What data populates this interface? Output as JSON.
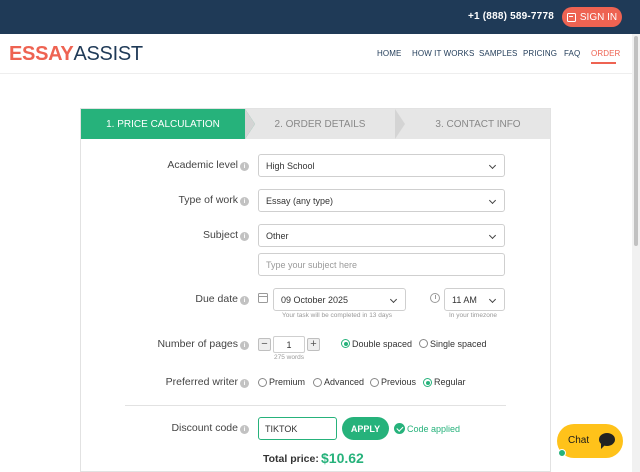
{
  "topbar": {
    "phone": "+1 (888) 589-7778",
    "signin_label": "SIGN IN"
  },
  "logo": {
    "part1": "ESSAY",
    "part2": "ASSIST"
  },
  "nav": [
    "HOME",
    "HOW IT WORKS",
    "SAMPLES",
    "PRICING",
    "FAQ",
    "ORDER"
  ],
  "nav_active": "ORDER",
  "steps": [
    "1. PRICE CALCULATION",
    "2. ORDER DETAILS",
    "3. CONTACT INFO"
  ],
  "form": {
    "academic_level": {
      "label": "Academic level",
      "value": "High School"
    },
    "type_of_work": {
      "label": "Type of work",
      "value": "Essay (any type)"
    },
    "subject": {
      "label": "Subject",
      "value": "Other",
      "placeholder": "Type your subject here"
    },
    "due_date": {
      "label": "Due date",
      "date": "09 October 2025",
      "date_hint": "Your task will be completed in 13 days",
      "time": "11 AM",
      "time_hint": "In your timezone"
    },
    "pages": {
      "label": "Number of pages",
      "value": "1",
      "words": "275 words",
      "minus": "−",
      "plus": "+",
      "options": [
        "Double spaced",
        "Single spaced"
      ],
      "selected": "Double spaced"
    },
    "writer": {
      "label": "Preferred writer",
      "options": [
        "Premium",
        "Advanced",
        "Previous",
        "Regular"
      ],
      "selected": "Regular"
    },
    "discount": {
      "label": "Discount code",
      "value": "TIKTOK",
      "apply_label": "APPLY",
      "status": "Code applied"
    },
    "total": {
      "label": "Total price:",
      "value": "$10.62"
    }
  },
  "info_glyph": "i",
  "chat": {
    "label": "Chat"
  },
  "colors": {
    "navy": "#1f3a57",
    "coral": "#ee6352",
    "green": "#26b27b",
    "chat_yellow": "#ffc21a"
  }
}
